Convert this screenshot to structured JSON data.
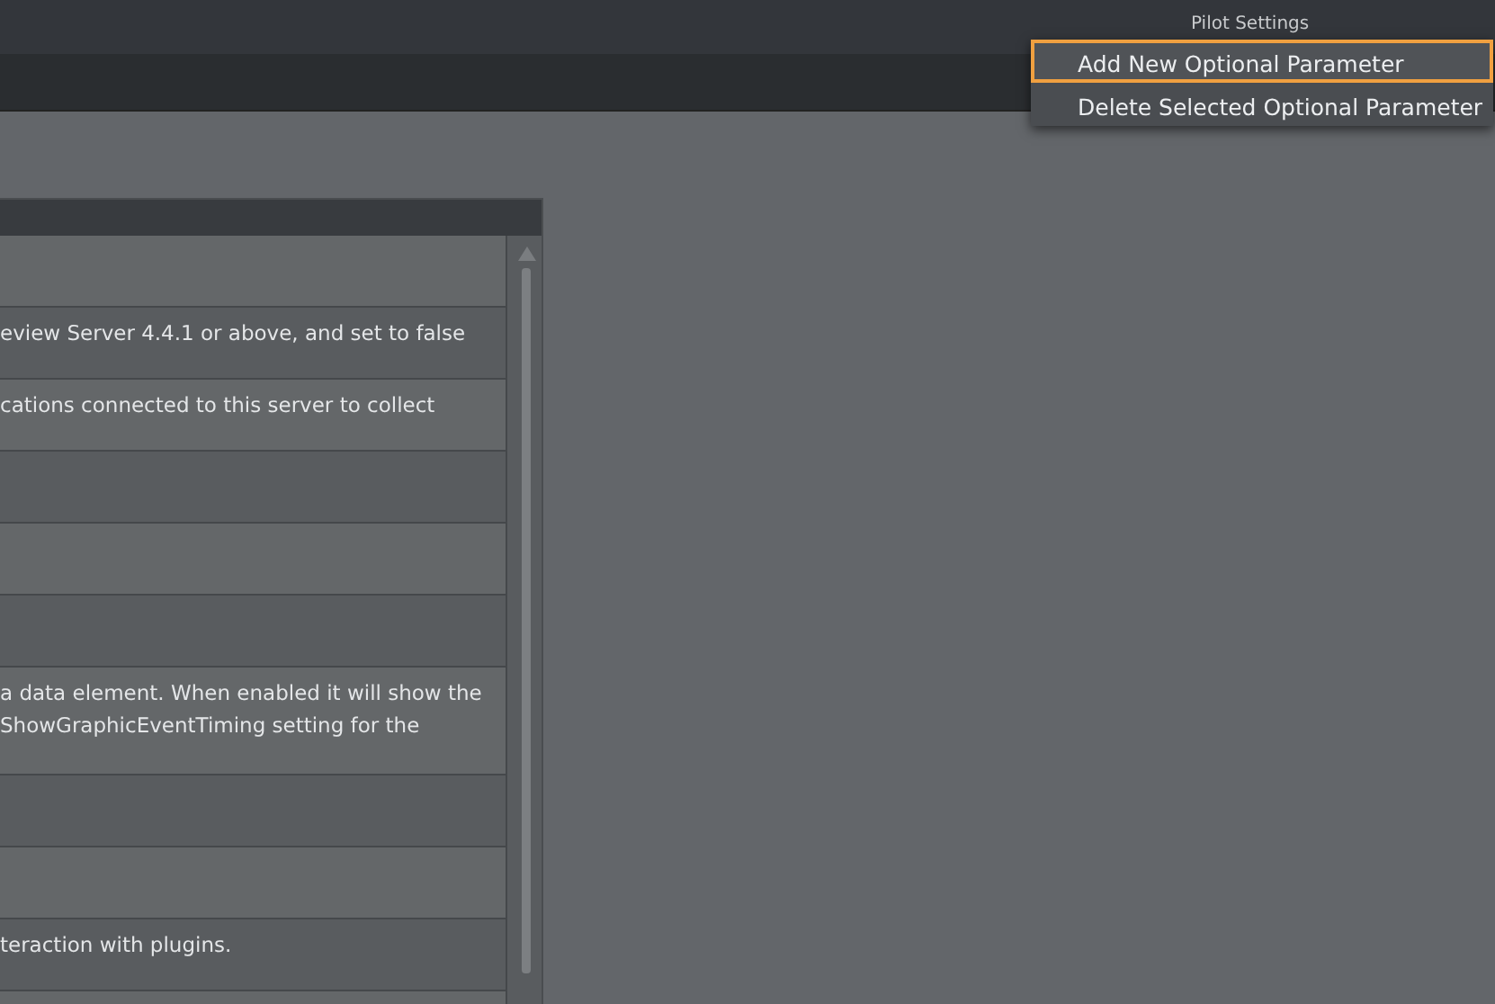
{
  "header": {
    "title": "Pilot Settings"
  },
  "menu": [
    {
      "label": "Add New Optional Parameter",
      "selected": true
    },
    {
      "label": "Delete Selected Optional Parameter",
      "selected": false
    }
  ],
  "table": {
    "rows": [
      {},
      {
        "lines": [
          "eview Server 4.4.1 or above, and set to false"
        ]
      },
      {
        "lines": [
          "cations connected to this server to collect"
        ]
      },
      {},
      {},
      {},
      {
        "lines": [
          "a data element. When enabled it will show the",
          "ShowGraphicEventTiming setting for the"
        ]
      },
      {},
      {},
      {
        "lines": [
          "teraction with plugins."
        ]
      },
      {}
    ]
  }
}
